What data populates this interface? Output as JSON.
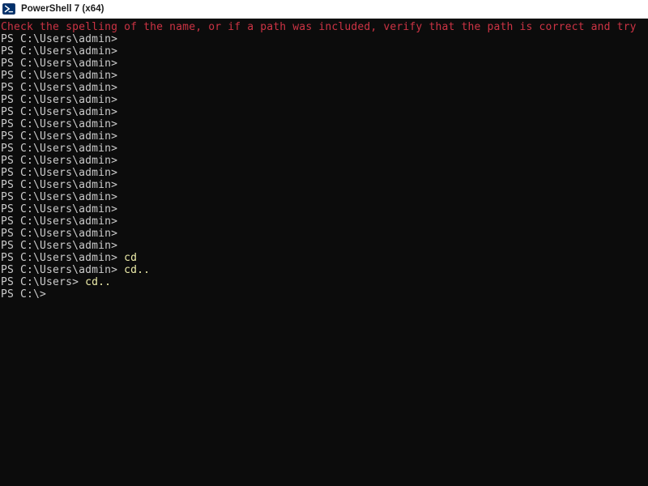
{
  "window": {
    "title": "PowerShell 7 (x64)",
    "icon": "powershell-icon",
    "titlebar_bg": "#ffffff",
    "titlebar_fg": "#1a1a1a"
  },
  "terminal": {
    "background": "#0c0c0c",
    "prompt_color": "#cccccc",
    "command_color": "#eeedaa",
    "error_color": "#cc3344",
    "prompt_admin": "PS C:\\Users\\admin>",
    "prompt_users": "PS C:\\Users>",
    "prompt_root": "PS C:\\>",
    "error_line": "Check the spelling of the name, or if a path was included, verify that the path is correct and try",
    "lines": [
      {
        "type": "error",
        "text": "Check the spelling of the name, or if a path was included, verify that the path is correct and try"
      },
      {
        "type": "prompt",
        "text": "PS C:\\Users\\admin>"
      },
      {
        "type": "prompt",
        "text": "PS C:\\Users\\admin>"
      },
      {
        "type": "prompt",
        "text": "PS C:\\Users\\admin>"
      },
      {
        "type": "prompt",
        "text": "PS C:\\Users\\admin>"
      },
      {
        "type": "prompt",
        "text": "PS C:\\Users\\admin>"
      },
      {
        "type": "prompt",
        "text": "PS C:\\Users\\admin>"
      },
      {
        "type": "prompt",
        "text": "PS C:\\Users\\admin>"
      },
      {
        "type": "prompt",
        "text": "PS C:\\Users\\admin>"
      },
      {
        "type": "prompt",
        "text": "PS C:\\Users\\admin>"
      },
      {
        "type": "prompt",
        "text": "PS C:\\Users\\admin>"
      },
      {
        "type": "prompt",
        "text": "PS C:\\Users\\admin>"
      },
      {
        "type": "prompt",
        "text": "PS C:\\Users\\admin>"
      },
      {
        "type": "prompt",
        "text": "PS C:\\Users\\admin>"
      },
      {
        "type": "prompt",
        "text": "PS C:\\Users\\admin>"
      },
      {
        "type": "prompt",
        "text": "PS C:\\Users\\admin>"
      },
      {
        "type": "prompt",
        "text": "PS C:\\Users\\admin>"
      },
      {
        "type": "prompt",
        "text": "PS C:\\Users\\admin>"
      },
      {
        "type": "prompt",
        "text": "PS C:\\Users\\admin>"
      },
      {
        "type": "command",
        "text": "PS C:\\Users\\admin> ",
        "command": "cd"
      },
      {
        "type": "command",
        "text": "PS C:\\Users\\admin> ",
        "command": "cd.."
      },
      {
        "type": "command",
        "text": "PS C:\\Users> ",
        "command": "cd.."
      },
      {
        "type": "prompt",
        "text": "PS C:\\>"
      }
    ]
  }
}
